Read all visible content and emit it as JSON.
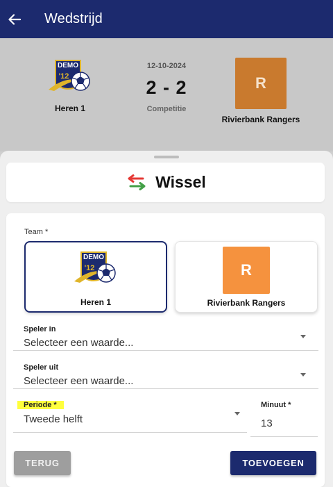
{
  "appbar": {
    "title": "Wedstrijd",
    "back_icon": "arrow-left-icon"
  },
  "match": {
    "home": {
      "name": "Heren 1",
      "logo_text": "DEMO",
      "logo_year": "'12"
    },
    "away": {
      "name": "Rivierbank Rangers",
      "logo_letter": "R",
      "logo_color": "#c97a2e"
    },
    "date": "12-10-2024",
    "score": "2 - 2",
    "type": "Competitie"
  },
  "action": {
    "title": "Wissel",
    "icon": "swap-arrows-icon"
  },
  "form": {
    "team_label": "Team *",
    "teams": [
      {
        "name": "Heren 1",
        "selected": true,
        "logo_text": "DEMO",
        "logo_year": "'12"
      },
      {
        "name": "Rivierbank Rangers",
        "selected": false,
        "logo_letter": "R",
        "logo_color": "#f5923e"
      }
    ],
    "speler_in": {
      "label": "Speler in",
      "value": "Selecteer een waarde..."
    },
    "speler_uit": {
      "label": "Speler uit",
      "value": "Selecteer een waarde..."
    },
    "periode": {
      "label": "Periode *",
      "value": "Tweede helft"
    },
    "minuut": {
      "label": "Minuut *",
      "value": "13"
    },
    "back_button": "TERUG",
    "add_button": "TOEVOEGEN"
  },
  "colors": {
    "primary": "#1c2a6e",
    "highlight": "#ffff3d",
    "swap_red": "#e53935",
    "swap_green": "#43a047"
  }
}
